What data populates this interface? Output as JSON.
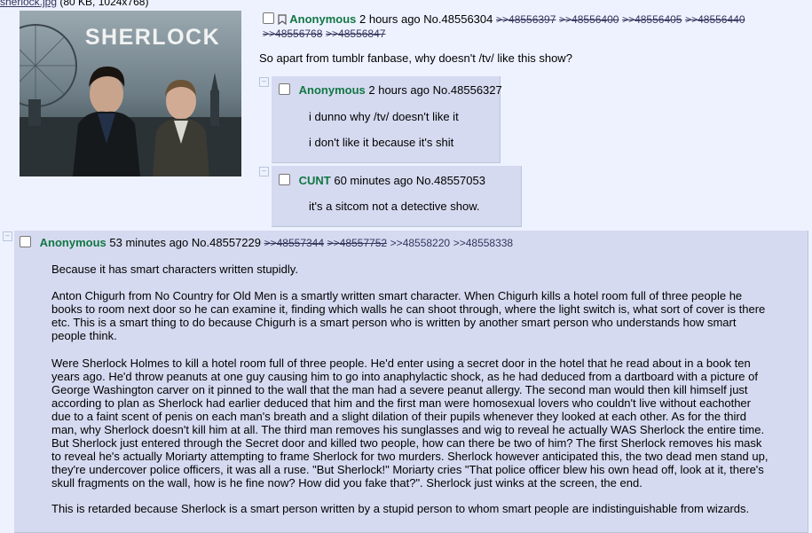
{
  "op": {
    "file_name": "sherlock.jpg",
    "file_meta": "(80 KB, 1024x768)",
    "image_title_text": "SHERLOCK",
    "name": "Anonymous",
    "time": "2 hours ago",
    "number": "No.48556304",
    "backlinks": [
      ">>48556397",
      ">>48556400",
      ">>48556405",
      ">>48556440",
      ">>48556768",
      ">>48556847"
    ],
    "message": "So apart from tumblr fanbase, why doesn't /tv/ like this show?"
  },
  "replies": [
    {
      "name": "Anonymous",
      "time": "2 hours ago",
      "number": "No.48556327",
      "lines": [
        "i dunno why /tv/ doesn't like it",
        "i don't like it because it's shit"
      ]
    },
    {
      "name": "CUNT",
      "time": "60 minutes ago",
      "number": "No.48557053",
      "lines": [
        "it's a sitcom not a detective show."
      ]
    },
    {
      "name": "Anonymous",
      "time": "53 minutes ago",
      "number": "No.48557229",
      "backlinks_dead": [
        ">>48557344",
        ">>48557752"
      ],
      "backlinks_live": [
        ">>48558220",
        ">>48558338"
      ],
      "paragraphs": [
        "Because it has smart characters written stupidly.",
        "Anton Chigurh from No Country for Old Men is a smartly written smart character. When Chigurh kills a hotel room full of three people he books to room next door so he can examine it, finding which walls he can shoot through, where the light switch is, what sort of cover is there etc. This is a smart thing to do because Chigurh is a smart person who is written by another smart person who understands how smart people think.",
        "Were Sherlock Holmes to kill a hotel room full of three people. He'd enter using a secret door in the hotel that he read about in a book ten years ago. He'd throw peanuts at one guy causing him to go into anaphylactic shock, as he had deduced from a dartboard with a picture of George Washington carver on it pinned to the wall that the man had a severe peanut allergy. The second man would then kill himself just according to plan as Sherlock had earlier deduced that him and the first man were homosexual lovers who couldn't live without eachother due to a faint scent of penis on each man's breath and a slight dilation of their pupils whenever they looked at each other. As for the third man, why Sherlock doesn't kill him at all. The third man removes his sunglasses and wig to reveal he actually WAS Sherlock the entire time. But Sherlock just entered through the Secret door and killed two people, how can there be two of him? The first Sherlock removes his mask to reveal he's actually Moriarty attempting to frame Sherlock for two murders. Sherlock however anticipated this, the two dead men stand up, they're undercover police officers, it was all a ruse. \"But Sherlock!\" Moriarty cries \"That police officer blew his own head off, look at it, there's skull fragments on the wall, how is he fine now? How did you fake that?\". Sherlock just winks at the screen, the end.",
        "This is retarded because Sherlock is a smart person written by a stupid person to whom smart people are indistinguishable from wizards."
      ]
    }
  ]
}
